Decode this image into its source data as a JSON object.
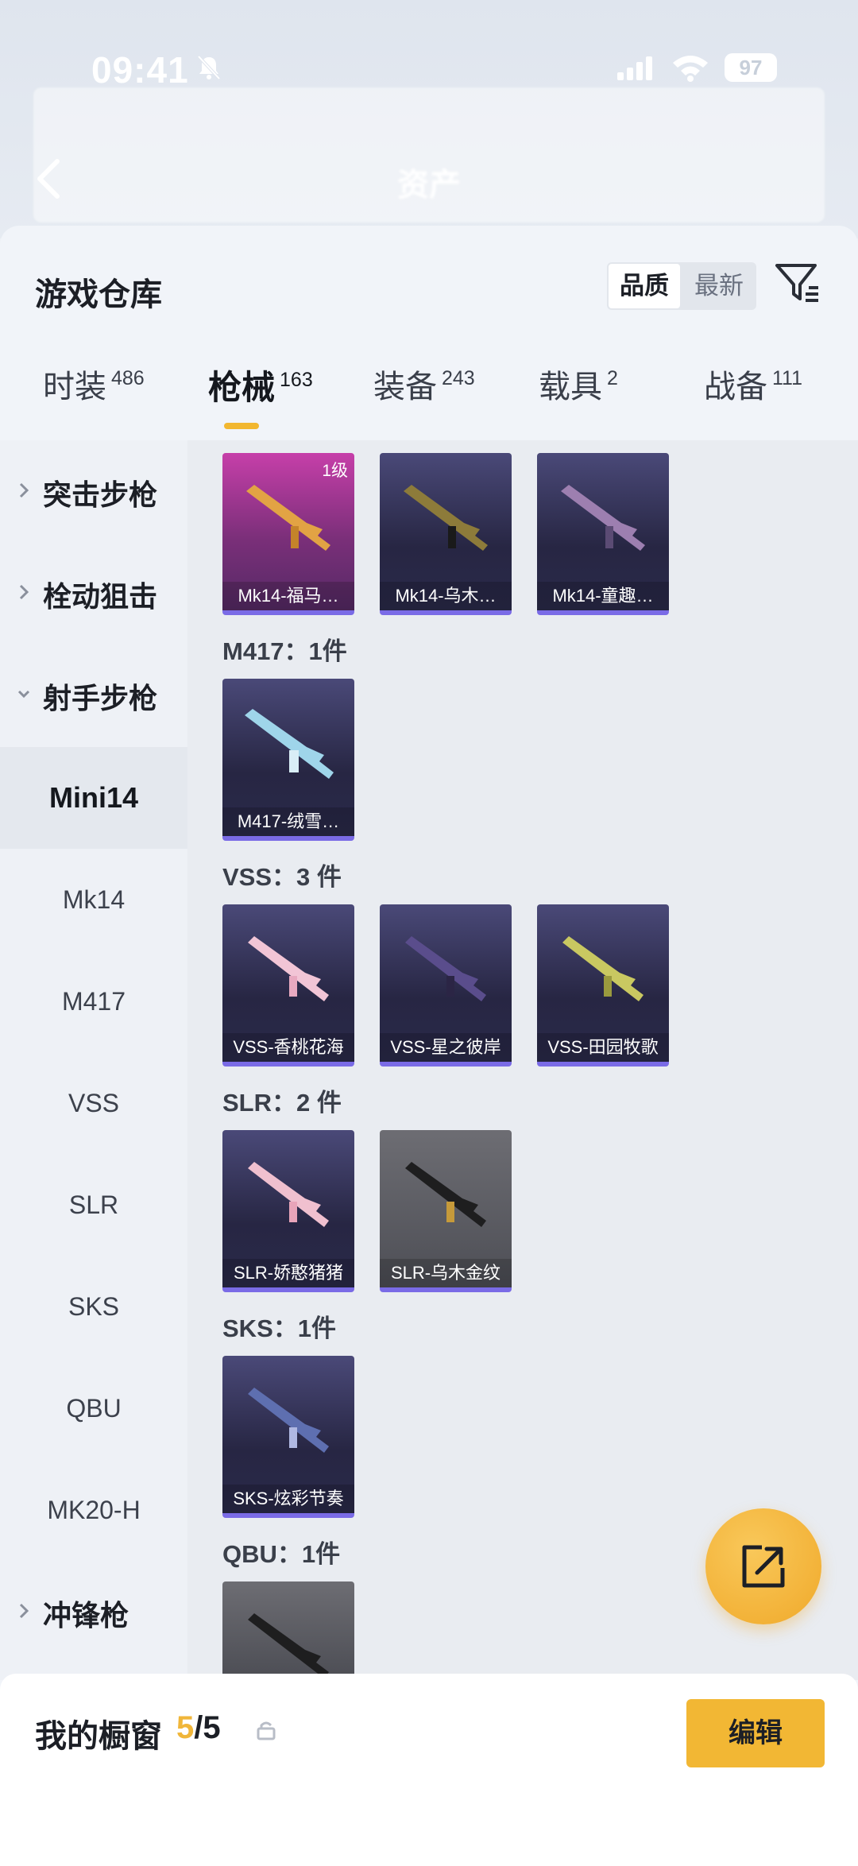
{
  "status_bar": {
    "time": "09:41",
    "battery": "97"
  },
  "background_header": {
    "title": "资产"
  },
  "sheet": {
    "title": "游戏仓库",
    "sort_options": [
      "品质",
      "最新"
    ],
    "active_sort": "品质"
  },
  "tabs": [
    {
      "label": "时装",
      "count": "486"
    },
    {
      "label": "枪械",
      "count": "163",
      "active": true
    },
    {
      "label": "装备",
      "count": "243"
    },
    {
      "label": "载具",
      "count": "2"
    },
    {
      "label": "战备",
      "count": "111"
    }
  ],
  "sidebar": {
    "categories": [
      {
        "label": "突击步枪",
        "expanded": false
      },
      {
        "label": "栓动狙击",
        "expanded": false
      },
      {
        "label": "射手步枪",
        "expanded": true
      }
    ],
    "subitems": [
      "Mini14",
      "Mk14",
      "M417",
      "VSS",
      "SLR",
      "SKS",
      "QBU",
      "MK20-H"
    ],
    "active_subitem": "Mini14",
    "bottom_category": {
      "label": "冲锋枪",
      "expanded": false
    }
  },
  "groups": {
    "mk14": {
      "items": [
        "Mk14-福马…",
        "Mk14-乌木…",
        "Mk14-童趣…"
      ],
      "level_badge": "1级"
    },
    "m417": {
      "label": "M417：1件",
      "items": [
        "M417-绒雪…"
      ]
    },
    "vss": {
      "label": "VSS：3 件",
      "items": [
        "VSS-香桃花海",
        "VSS-星之彼岸",
        "VSS-田园牧歌"
      ]
    },
    "slr": {
      "label": "SLR：2 件",
      "items": [
        "SLR-娇憨猪猪",
        "SLR-乌木金纹"
      ]
    },
    "sks": {
      "label": "SKS：1件",
      "items": [
        "SKS-炫彩节奏"
      ]
    },
    "qbu": {
      "label": "QBU：1件"
    }
  },
  "bottom_bar": {
    "label": "我的橱窗",
    "current": "5",
    "separator": "/",
    "total": "5",
    "edit_label": "编辑"
  },
  "colors": {
    "accent": "#f2b734",
    "card_purple": "#272643",
    "card_pink": "#c63fa9",
    "underline": "#7a6be6"
  }
}
